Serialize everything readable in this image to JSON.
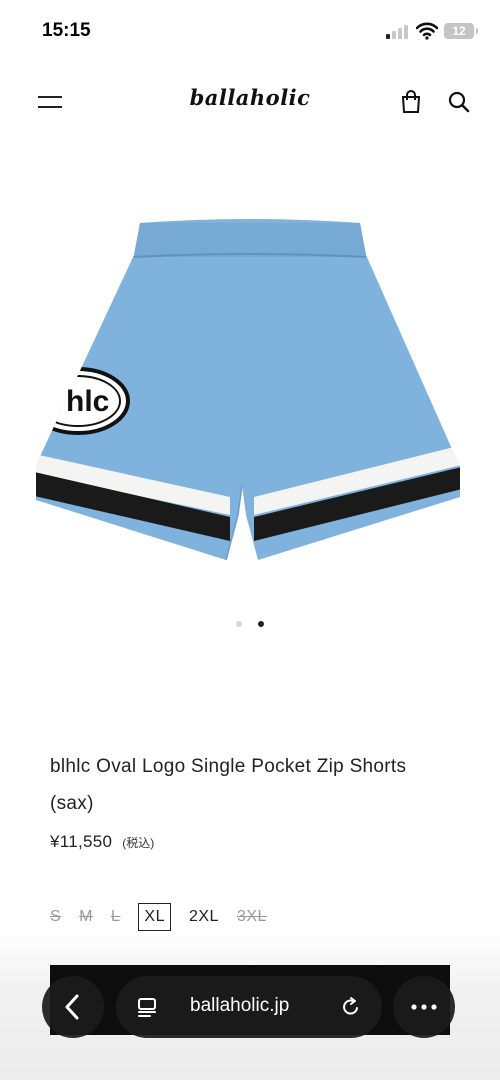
{
  "status_bar": {
    "time": "15:15",
    "battery": "12"
  },
  "header": {
    "logo": "ballaholic",
    "icons": [
      "menu-icon",
      "bag-icon",
      "search-icon"
    ]
  },
  "product": {
    "image_colors": {
      "shorts": "#7fb2dc",
      "stripe_white": "#f4f4f2",
      "stripe_black": "#1a1a1a"
    },
    "image_logo_text": "hlc",
    "carousel": {
      "count": 2,
      "active_index": 1
    },
    "title": "blhlc Oval Logo Single Pocket Zip Shorts (sax)",
    "price": "¥11,550",
    "tax_label": "(税込)",
    "sizes": [
      {
        "label": "S",
        "status": "soldout"
      },
      {
        "label": "M",
        "status": "soldout"
      },
      {
        "label": "L",
        "status": "soldout"
      },
      {
        "label": "XL",
        "status": "selected"
      },
      {
        "label": "2XL",
        "status": "available"
      },
      {
        "label": "3XL",
        "status": "soldout"
      }
    ]
  },
  "browser": {
    "url": "ballaholic.jp",
    "icons": [
      "back-icon",
      "reader-icon",
      "reload-icon",
      "more-icon"
    ]
  }
}
